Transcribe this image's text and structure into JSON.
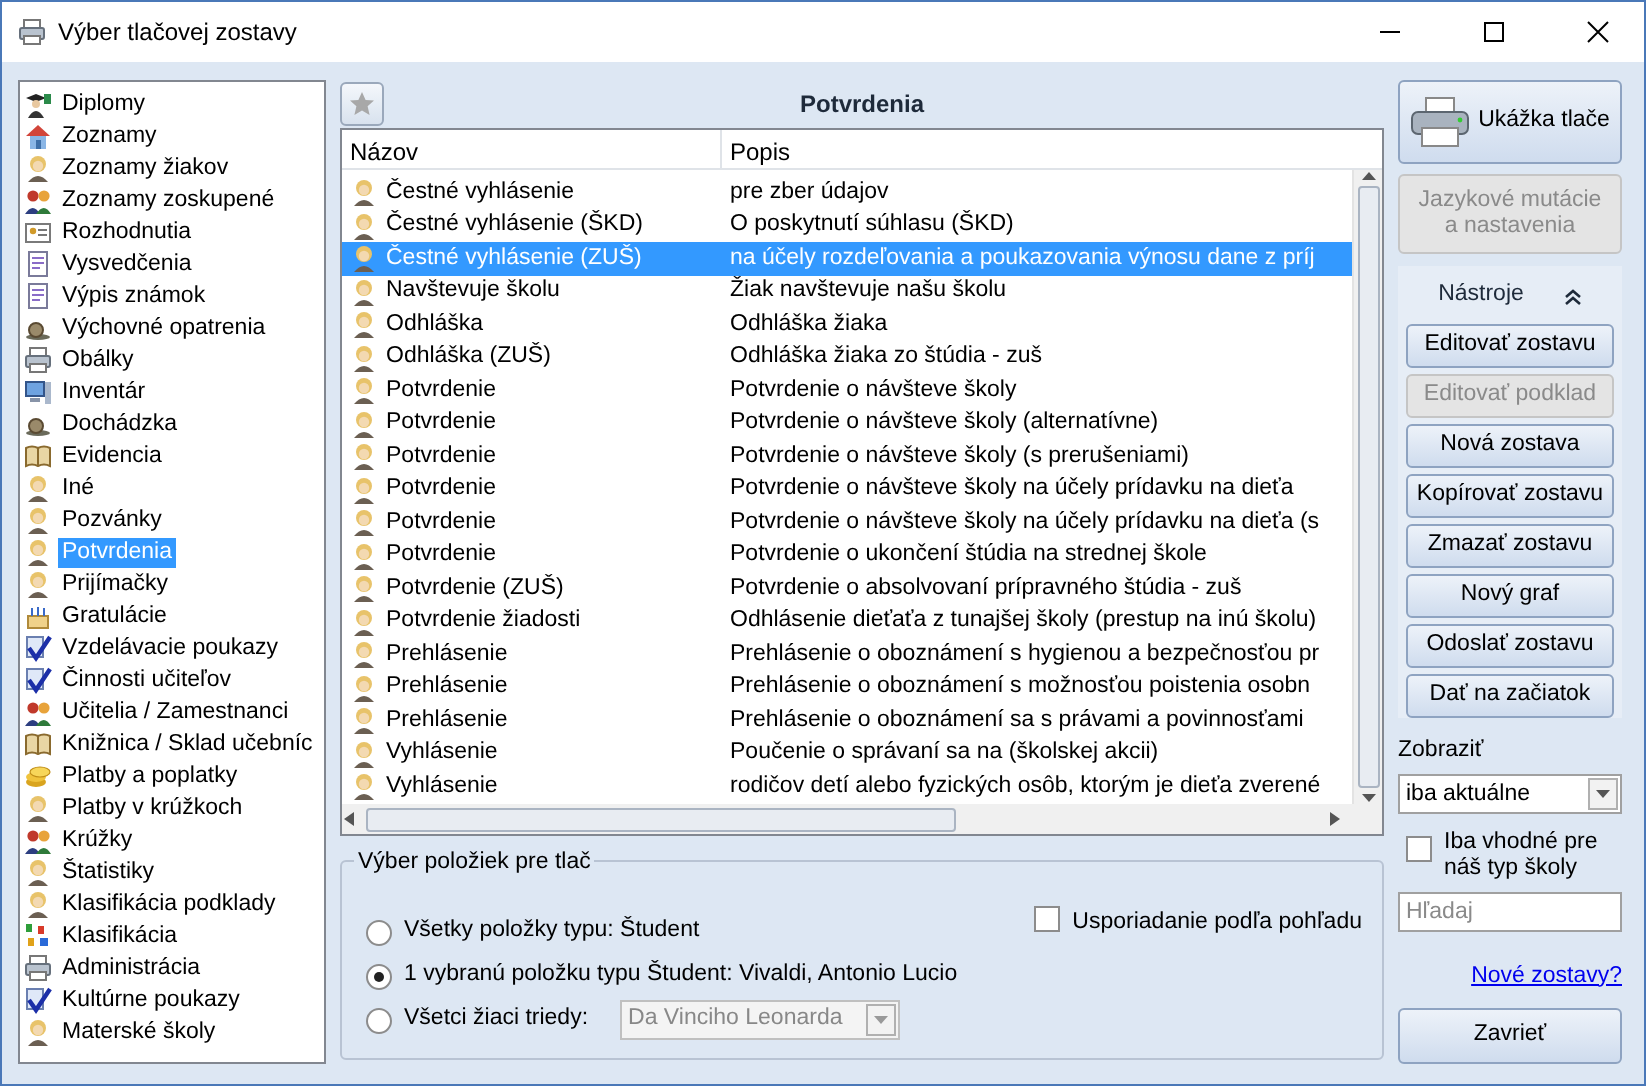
{
  "window": {
    "title": "Výber tlačovej zostavy"
  },
  "sidebar": {
    "items": [
      {
        "label": "Diplomy",
        "selected": false
      },
      {
        "label": "Zoznamy",
        "selected": false
      },
      {
        "label": "Zoznamy žiakov",
        "selected": false
      },
      {
        "label": "Zoznamy zoskupené",
        "selected": false
      },
      {
        "label": "Rozhodnutia",
        "selected": false
      },
      {
        "label": "Vysvedčenia",
        "selected": false
      },
      {
        "label": "Výpis známok",
        "selected": false
      },
      {
        "label": "Výchovné opatrenia",
        "selected": false
      },
      {
        "label": "Obálky",
        "selected": false
      },
      {
        "label": "Inventár",
        "selected": false
      },
      {
        "label": "Dochádzka",
        "selected": false
      },
      {
        "label": "Evidencia",
        "selected": false
      },
      {
        "label": "Iné",
        "selected": false
      },
      {
        "label": "Pozvánky",
        "selected": false
      },
      {
        "label": "Potvrdenia",
        "selected": true
      },
      {
        "label": "Prijímačky",
        "selected": false
      },
      {
        "label": "Gratulácie",
        "selected": false
      },
      {
        "label": "Vzdelávacie poukazy",
        "selected": false
      },
      {
        "label": "Činnosti učiteľov",
        "selected": false
      },
      {
        "label": "Učitelia / Zamestnanci",
        "selected": false
      },
      {
        "label": "Knižnica / Sklad učebníc",
        "selected": false
      },
      {
        "label": "Platby a poplatky",
        "selected": false
      },
      {
        "label": "Platby v krúžkoch",
        "selected": false
      },
      {
        "label": "Krúžky",
        "selected": false
      },
      {
        "label": "Štatistiky",
        "selected": false
      },
      {
        "label": "Klasifikácia podklady",
        "selected": false
      },
      {
        "label": "Klasifikácia",
        "selected": false
      },
      {
        "label": "Administrácia",
        "selected": false
      },
      {
        "label": "Kultúrne poukazy",
        "selected": false
      },
      {
        "label": "Materské školy",
        "selected": false
      }
    ]
  },
  "panel": {
    "title": "Potvrdenia"
  },
  "table": {
    "columns": [
      "Názov",
      "Popis"
    ],
    "rows": [
      {
        "cells": [
          "Čestné vyhlásenie",
          "pre zber údajov"
        ],
        "selected": false
      },
      {
        "cells": [
          "Čestné vyhlásenie  (ŠKD)",
          "O poskytnutí súhlasu (ŠKD)"
        ],
        "selected": false
      },
      {
        "cells": [
          "Čestné vyhlásenie (ZUŠ)",
          "na účely rozdeľovania a poukazovania výnosu dane z príj"
        ],
        "selected": true
      },
      {
        "cells": [
          "Navštevuje školu",
          "Žiak navštevuje našu školu"
        ],
        "selected": false
      },
      {
        "cells": [
          "Odhláška",
          "Odhláška žiaka"
        ],
        "selected": false
      },
      {
        "cells": [
          "Odhláška (ZUŠ)",
          "Odhláška žiaka zo štúdia - zuš"
        ],
        "selected": false
      },
      {
        "cells": [
          "Potvrdenie",
          "Potvrdenie o návšteve školy"
        ],
        "selected": false
      },
      {
        "cells": [
          "Potvrdenie",
          "Potvrdenie o návšteve školy (alternatívne)"
        ],
        "selected": false
      },
      {
        "cells": [
          "Potvrdenie",
          "Potvrdenie o návšteve školy (s prerušeniami)"
        ],
        "selected": false
      },
      {
        "cells": [
          "Potvrdenie",
          "Potvrdenie o návšteve školy na účely prídavku na dieťa"
        ],
        "selected": false
      },
      {
        "cells": [
          "Potvrdenie",
          "Potvrdenie o návšteve školy na účely prídavku na dieťa (s"
        ],
        "selected": false
      },
      {
        "cells": [
          "Potvrdenie",
          "Potvrdenie o ukončení štúdia na strednej škole"
        ],
        "selected": false
      },
      {
        "cells": [
          "Potvrdenie (ZUŠ)",
          "Potvrdenie o absolvovaní prípravného štúdia - zuš"
        ],
        "selected": false
      },
      {
        "cells": [
          "Potvrdenie žiadosti",
          "Odhlásenie dieťaťa z tunajšej školy (prestup na inú školu)"
        ],
        "selected": false
      },
      {
        "cells": [
          "Prehlásenie",
          "Prehlásenie o oboznámení s hygienou a bezpečnosťou pr"
        ],
        "selected": false
      },
      {
        "cells": [
          "Prehlásenie",
          "Prehlásenie o oboznámení s možnosťou poistenia osobn"
        ],
        "selected": false
      },
      {
        "cells": [
          "Prehlásenie",
          "Prehlásenie o oboznámení sa s právami a povinnosťami"
        ],
        "selected": false
      },
      {
        "cells": [
          "Vyhlásenie",
          "Poučenie o správaní sa na (školskej akcii)"
        ],
        "selected": false
      },
      {
        "cells": [
          "Vyhlásenie",
          "rodičov detí alebo fyzických osôb, ktorým je dieťa zverené"
        ],
        "selected": false
      }
    ]
  },
  "print_selection": {
    "title": "Výber položiek pre tlač",
    "options": [
      {
        "label": "Všetky položky typu: Študent",
        "selected": false
      },
      {
        "label": "1 vybranú položku typu Študent: Vivaldi, Antonio Lucio",
        "selected": true
      },
      {
        "label": "Všetci žiaci triedy:",
        "selected": false,
        "select": {
          "value": "Da Vinciho Leonarda",
          "disabled": true
        }
      }
    ],
    "sort_by_view": {
      "label": "Usporiadanie podľa pohľadu",
      "checked": false
    }
  },
  "actions": {
    "preview": {
      "label": "Ukážka tlače",
      "disabled": false
    },
    "language": {
      "label": "Jazykové mutácie a nastavenia",
      "disabled": true
    },
    "tools_title": "Nástroje",
    "tools": [
      {
        "label": "Editovať zostavu",
        "disabled": false
      },
      {
        "label": "Editovať podklad",
        "disabled": true
      },
      {
        "label": "Nová zostava",
        "disabled": false
      },
      {
        "label": "Kopírovať zostavu",
        "disabled": false
      },
      {
        "label": "Zmazať zostavu",
        "disabled": false
      },
      {
        "label": "Nový graf",
        "disabled": false
      },
      {
        "label": "Odoslať zostavu",
        "disabled": false
      },
      {
        "label": "Dať na začiatok",
        "disabled": false
      }
    ],
    "show_label": "Zobraziť",
    "show_value": "iba aktuálne",
    "school_type_filter": {
      "label": "Iba vhodné pre náš typ školy",
      "checked": false
    },
    "search": {
      "placeholder": "Hľadaj"
    },
    "new_reports_link": "Nové zostavy?",
    "close": "Zavrieť"
  }
}
